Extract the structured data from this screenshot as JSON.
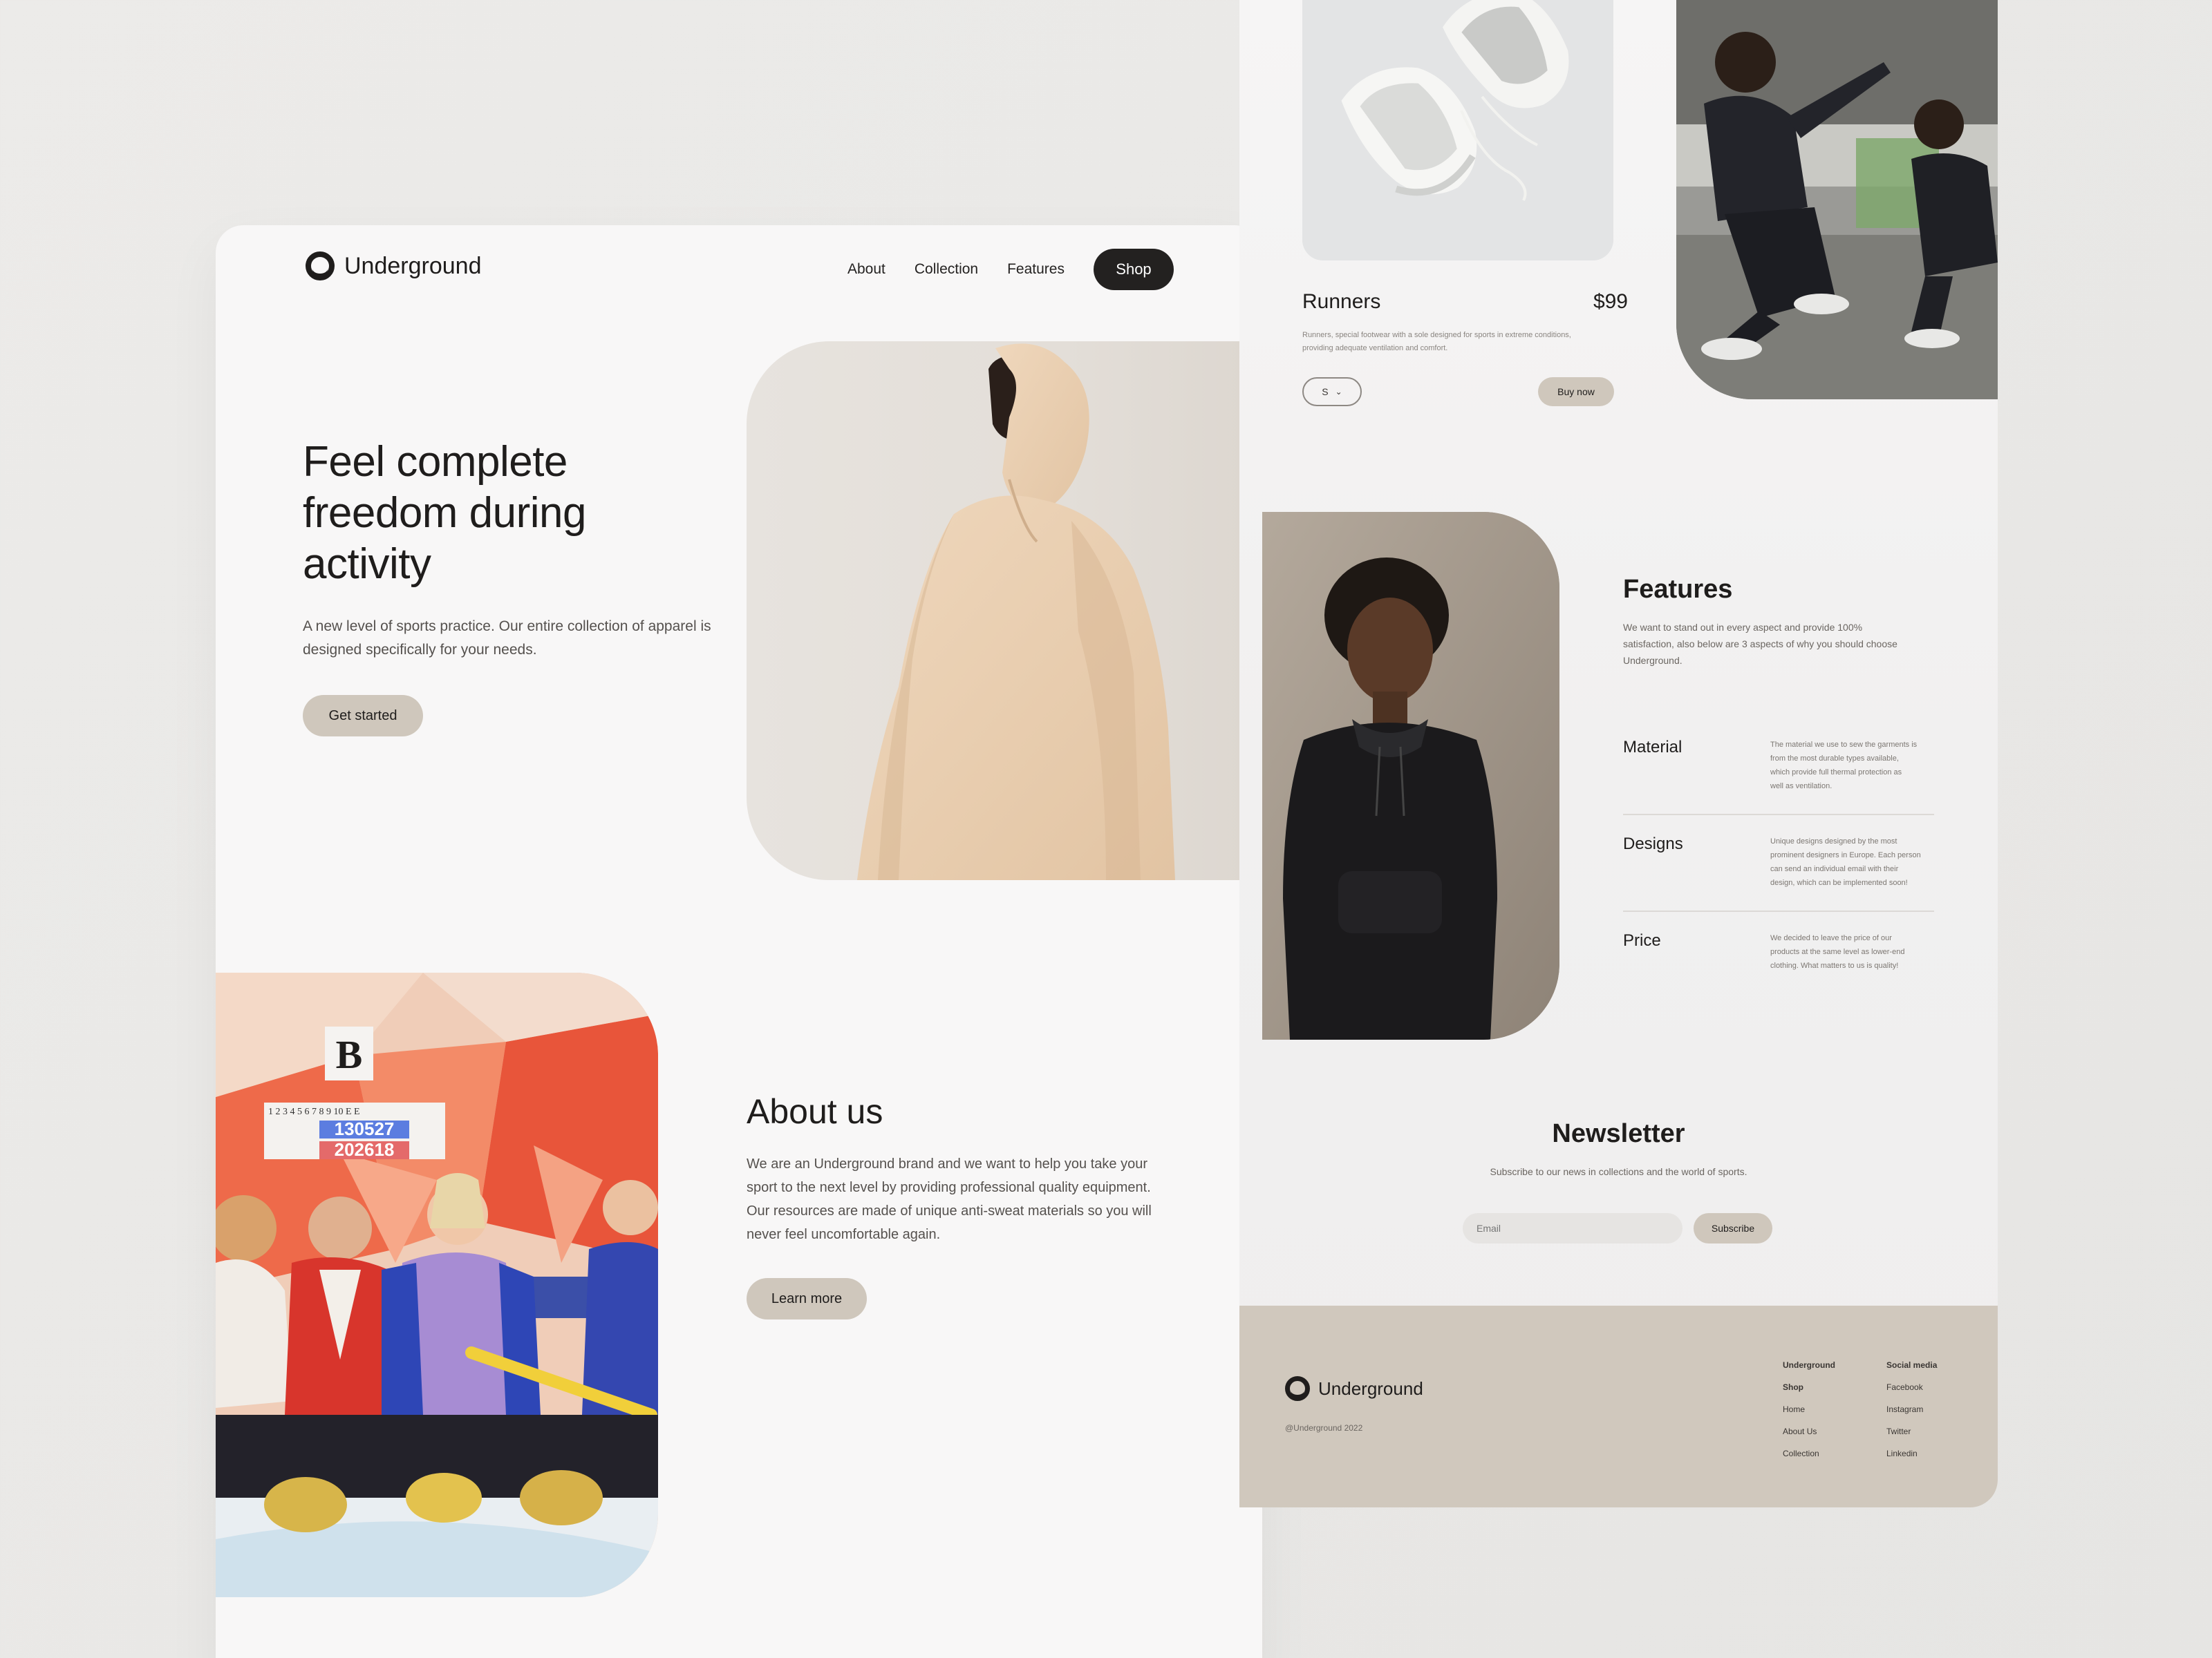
{
  "brand": {
    "name": "Underground"
  },
  "nav": {
    "items": [
      "About",
      "Collection",
      "Features"
    ],
    "shop_label": "Shop"
  },
  "hero": {
    "title_lines": [
      "Feel complete",
      "freedom during",
      "activity"
    ],
    "subtitle_lines": [
      "A new level of sports practice. Our entire collection of apparel is",
      "designed specifically for your needs."
    ],
    "cta": "Get started"
  },
  "about": {
    "title": "About us",
    "text_lines": [
      "We are an Underground brand and we want to help you take your",
      "sport to the next level by providing professional quality equipment.",
      "Our resources are made of unique anti-sweat materials so you will",
      "never feel uncomfortable again."
    ],
    "cta": "Learn more"
  },
  "product": {
    "name": "Runners",
    "price": "$99",
    "desc_lines": [
      "Runners, special footwear with a sole designed for sports in extreme conditions,",
      "providing adequate ventilation and comfort."
    ],
    "size_select": "S",
    "buy_label": "Buy now"
  },
  "features": {
    "title": "Features",
    "subtitle_lines": [
      "We want to stand out in every aspect and provide 100%",
      "satisfaction, also below are 3 aspects of why you should choose",
      "Underground."
    ],
    "items": [
      {
        "name": "Material",
        "desc_lines": [
          "The material we use to sew the garments is",
          "from the most durable types available,",
          "which provide full thermal protection as",
          "well as ventilation."
        ]
      },
      {
        "name": "Designs",
        "desc_lines": [
          "Unique designs designed by the most",
          "prominent designers in Europe. Each person",
          "can send an individual email with their",
          "design, which can be implemented soon!"
        ]
      },
      {
        "name": "Price",
        "desc_lines": [
          "We decided to leave the price of our",
          "products at the same level as lower-end",
          "clothing. What matters to us is quality!"
        ]
      }
    ]
  },
  "newsletter": {
    "title": "Newsletter",
    "subtitle": "Subscribe to our news in collections and the world of sports.",
    "email_placeholder": "Email",
    "subscribe_label": "Subscribe"
  },
  "footer": {
    "brand": "Underground",
    "copyright": "@Underground 2022",
    "col1": [
      "Underground",
      "Shop",
      "Home",
      "About Us",
      "Collection"
    ],
    "col2": [
      "Social media",
      "Facebook",
      "Instagram",
      "Twitter",
      "Linkedin"
    ]
  },
  "photo": {
    "scoreboard_letter": "B",
    "scoreboard_digits": "1 2 3 4 5 6 7 8 9 10 E E",
    "score_row1": "130527",
    "score_row2": "202618"
  },
  "colors": {
    "accent_pill": "#cfc7bc",
    "dark_button": "#232120",
    "footer_bg": "#d0c8bd",
    "page_bg": "#f8f7f7"
  }
}
